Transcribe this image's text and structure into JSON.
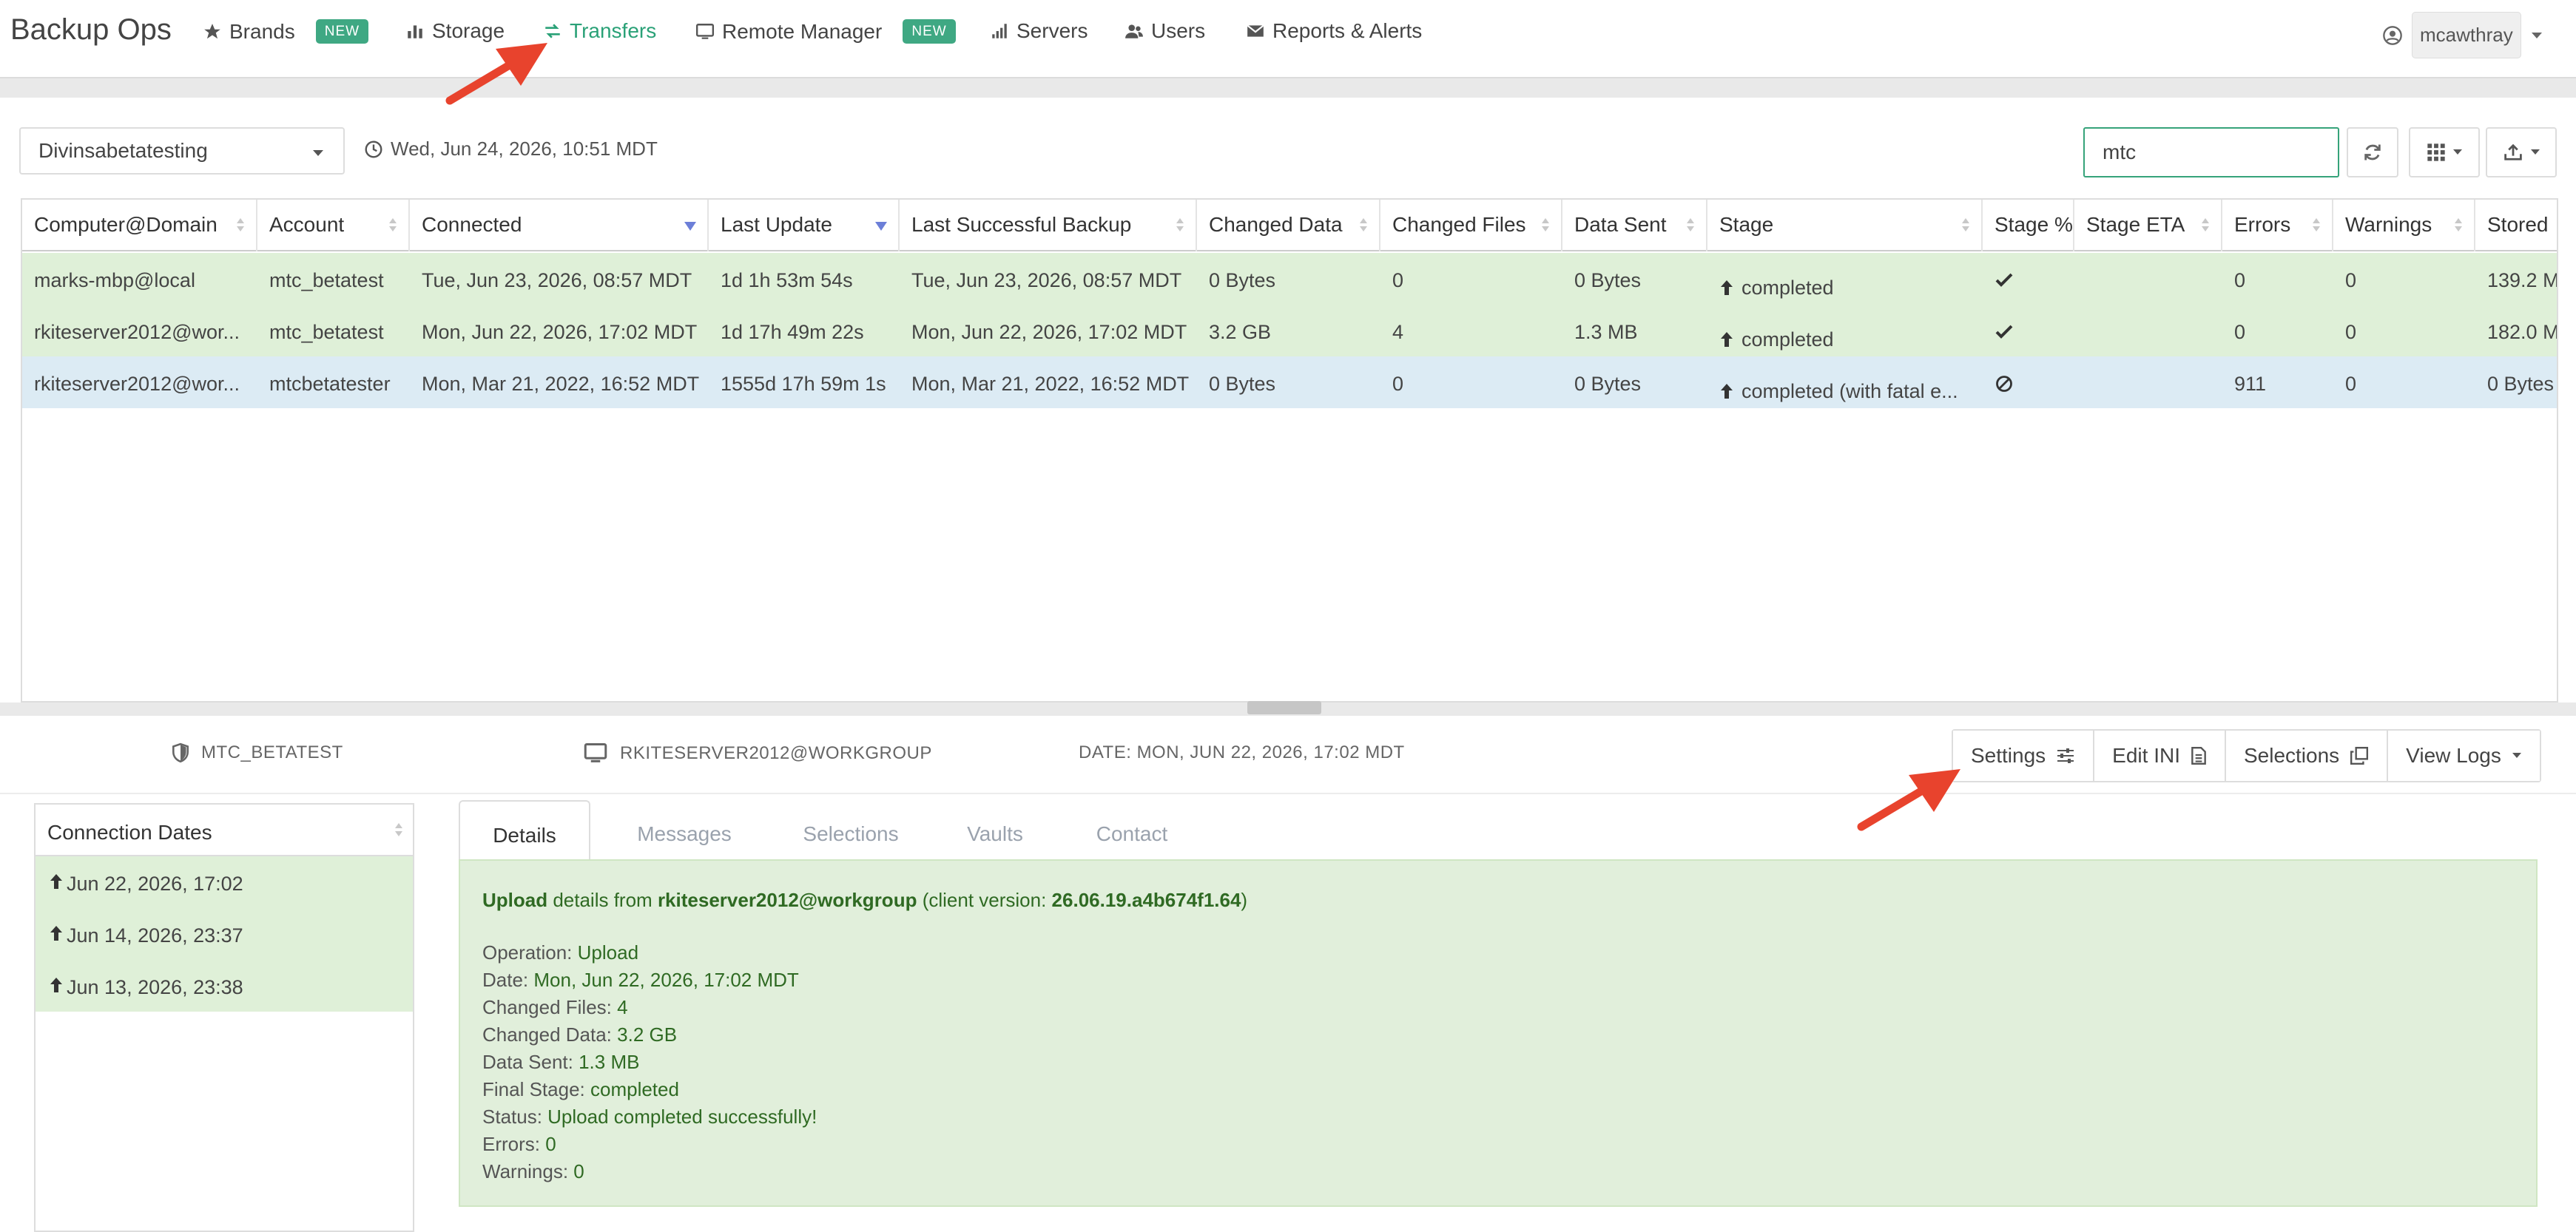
{
  "app": {
    "title": "Backup Ops"
  },
  "nav": {
    "items": [
      {
        "label": "Brands",
        "badge": "NEW",
        "icon": "star-icon"
      },
      {
        "label": "Storage",
        "icon": "bar-chart-icon"
      },
      {
        "label": "Transfers",
        "icon": "exchange-icon",
        "active": true
      },
      {
        "label": "Remote Manager",
        "badge": "NEW",
        "icon": "monitor-icon"
      },
      {
        "label": "Servers",
        "icon": "signal-icon"
      },
      {
        "label": "Users",
        "icon": "users-icon"
      },
      {
        "label": "Reports & Alerts",
        "icon": "envelope-icon"
      }
    ],
    "user": "mcawthray"
  },
  "toolbar": {
    "brand_select": "Divinsabetatesting",
    "datetime": "Wed, Jun 24, 2026, 10:51 MDT",
    "search_value": "mtc"
  },
  "table": {
    "columns": [
      "Computer@Domain",
      "Account",
      "Connected",
      "Last Update",
      "Last Successful Backup",
      "Changed Data",
      "Changed Files",
      "Data Sent",
      "Stage",
      "Stage %",
      "Stage ETA",
      "Errors",
      "Warnings",
      "Stored"
    ],
    "rows": [
      {
        "computer": "marks-mbp@local",
        "account": "mtc_betatest",
        "connected": "Tue, Jun 23, 2026, 08:57 MDT",
        "last_update": "1d 1h 53m 54s",
        "last_success": "Tue, Jun 23, 2026, 08:57 MDT",
        "changed_data": "0 Bytes",
        "changed_files": "0",
        "data_sent": "0 Bytes",
        "stage": "completed",
        "stage_pct": "check",
        "stage_eta": "",
        "errors": "0",
        "warnings": "0",
        "stored": "139.2 M"
      },
      {
        "computer": "rkiteserver2012@wor...",
        "account": "mtc_betatest",
        "connected": "Mon, Jun 22, 2026, 17:02 MDT",
        "last_update": "1d 17h 49m 22s",
        "last_success": "Mon, Jun 22, 2026, 17:02 MDT",
        "changed_data": "3.2 GB",
        "changed_files": "4",
        "data_sent": "1.3 MB",
        "stage": "completed",
        "stage_pct": "check",
        "stage_eta": "",
        "errors": "0",
        "warnings": "0",
        "stored": "182.0 M"
      },
      {
        "computer": "rkiteserver2012@wor...",
        "account": "mtcbetatester",
        "connected": "Mon, Mar 21, 2022, 16:52 MDT",
        "last_update": "1555d 17h 59m 1s",
        "last_success": "Mon, Mar 21, 2022, 16:52 MDT",
        "changed_data": "0 Bytes",
        "changed_files": "0",
        "data_sent": "0 Bytes",
        "stage": "completed (with fatal e...",
        "stage_pct": "ban",
        "stage_eta": "",
        "errors": "911",
        "warnings": "0",
        "stored": "0 Bytes"
      }
    ]
  },
  "detail_bar": {
    "account": "MTC_BETATEST",
    "computer": "RKITESERVER2012@WORKGROUP",
    "date": "DATE: MON, JUN 22, 2026, 17:02 MDT",
    "buttons": {
      "settings": "Settings",
      "edit_ini": "Edit INI",
      "selections": "Selections",
      "view_logs": "View Logs"
    }
  },
  "connection_dates": {
    "header": "Connection Dates",
    "items": [
      "Jun 22, 2026, 17:02",
      "Jun 14, 2026, 23:37",
      "Jun 13, 2026, 23:38"
    ]
  },
  "tabs": [
    "Details",
    "Messages",
    "Selections",
    "Vaults",
    "Contact"
  ],
  "details": {
    "header_operation": "Upload",
    "header_middle": " details from ",
    "header_host": "rkiteserver2012@workgroup",
    "header_client_prefix": " (client version: ",
    "header_version": "26.06.19.a4b674f1.64",
    "header_client_suffix": ")",
    "fields": [
      {
        "label": "Operation: ",
        "value": "Upload"
      },
      {
        "label": "Date: ",
        "value": "Mon, Jun 22, 2026, 17:02 MDT"
      },
      {
        "label": "Changed Files: ",
        "value": "4"
      },
      {
        "label": "Changed Data: ",
        "value": "3.2 GB"
      },
      {
        "label": "Data Sent: ",
        "value": "1.3 MB"
      },
      {
        "label": "Final Stage: ",
        "value": "completed"
      },
      {
        "label": "Status: ",
        "value": "Upload completed successfully!"
      },
      {
        "label": "Errors: ",
        "value": "0"
      },
      {
        "label": "Warnings: ",
        "value": "0"
      }
    ]
  },
  "colors": {
    "accent": "#2aa177",
    "row_green": "#dff0d8",
    "row_selected": "#dcebf4",
    "annotation_arrow": "#e8432d"
  }
}
